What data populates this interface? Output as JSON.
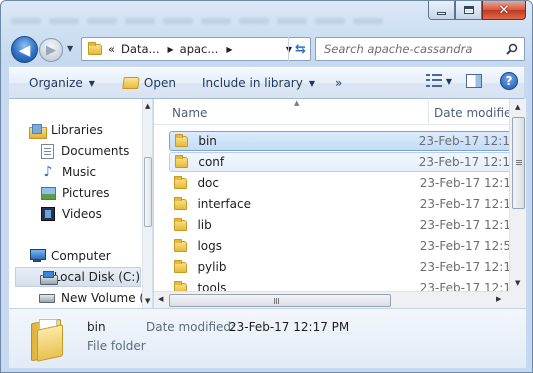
{
  "window": {
    "minimize_icon": "minimize-icon",
    "maximize_icon": "maximize-icon",
    "close_glyph": "✕"
  },
  "navigation": {
    "back_glyph": "◀",
    "forward_glyph": "▶",
    "breadcrumb": [
      "Data...",
      "apac..."
    ],
    "breadcrumb_prefix": "«",
    "refresh_glyph": "⇆"
  },
  "search": {
    "placeholder": "Search apache-cassandra"
  },
  "toolbar": {
    "organize_label": "Organize",
    "open_label": "Open",
    "include_label": "Include in library",
    "more_label": "»",
    "help_glyph": "?"
  },
  "sidebar": {
    "libraries_label": "Libraries",
    "library_items": [
      {
        "label": "Documents",
        "icon": "documents-icon"
      },
      {
        "label": "Music",
        "icon": "music-icon"
      },
      {
        "label": "Pictures",
        "icon": "pictures-icon"
      },
      {
        "label": "Videos",
        "icon": "videos-icon"
      }
    ],
    "computer_label": "Computer",
    "drives": [
      {
        "label": "Local Disk (C:)",
        "icon": "local-disk-icon",
        "selected": true
      },
      {
        "label": "New Volume (",
        "icon": "drive-icon",
        "selected": false
      }
    ]
  },
  "file_list": {
    "columns": {
      "name": "Name",
      "date": "Date modified"
    },
    "rows": [
      {
        "name": "bin",
        "date": "23-Feb-17 12:1",
        "state": "selected"
      },
      {
        "name": "conf",
        "date": "23-Feb-17 12:1",
        "state": "hover"
      },
      {
        "name": "doc",
        "date": "23-Feb-17 12:1",
        "state": ""
      },
      {
        "name": "interface",
        "date": "23-Feb-17 12:1",
        "state": ""
      },
      {
        "name": "lib",
        "date": "23-Feb-17 12:1",
        "state": ""
      },
      {
        "name": "logs",
        "date": "23-Feb-17 12:5",
        "state": ""
      },
      {
        "name": "pylib",
        "date": "23-Feb-17 12:1",
        "state": ""
      },
      {
        "name": "tools",
        "date": "23-Feb-17 12:1",
        "state": ""
      }
    ]
  },
  "details": {
    "name": "bin",
    "type": "File folder",
    "modified_label": "Date modified:",
    "modified_value": "23-Feb-17 12:17 PM"
  }
}
